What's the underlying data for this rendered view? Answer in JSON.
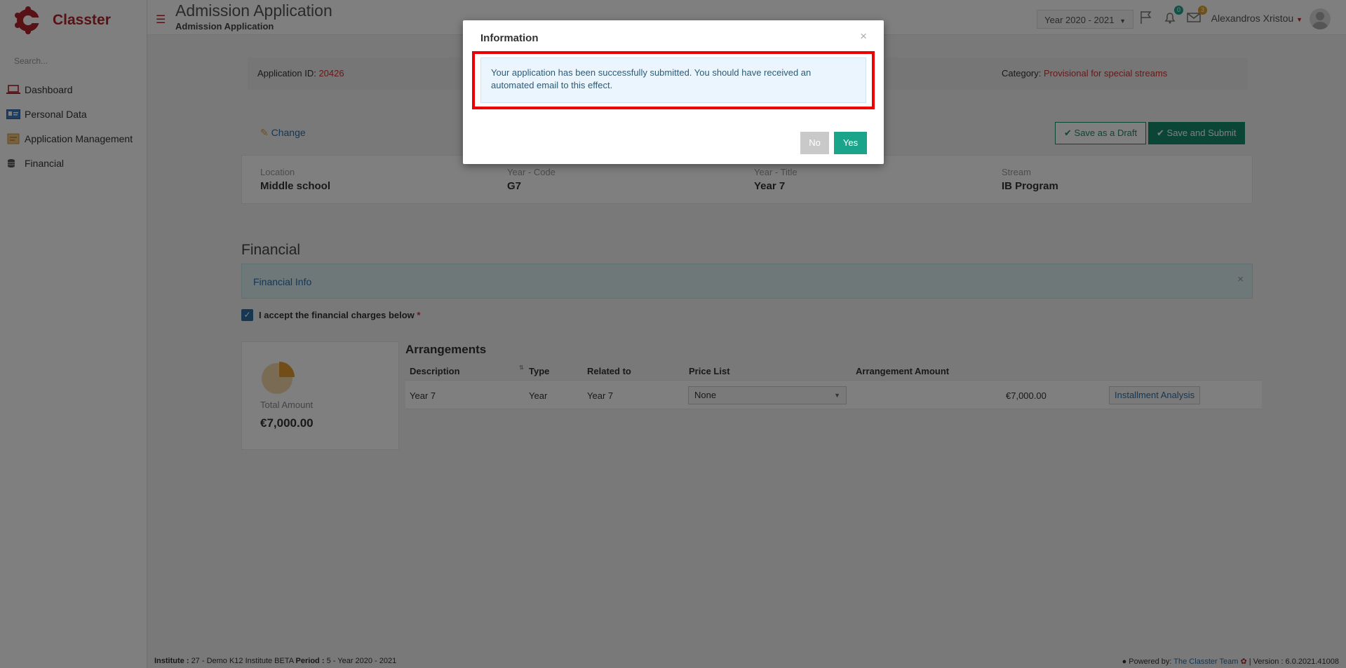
{
  "app": {
    "brand": "Classter"
  },
  "sidebar": {
    "search_placeholder": "Search...",
    "items": [
      {
        "label": "Dashboard",
        "icon": "laptop-icon"
      },
      {
        "label": "Personal Data",
        "icon": "id-card-icon"
      },
      {
        "label": "Application Management",
        "icon": "folder-icon"
      },
      {
        "label": "Financial",
        "icon": "coins-icon"
      }
    ]
  },
  "header": {
    "title": "Admission Application",
    "subtitle": "Admission Application",
    "year_select": "Year 2020 - 2021",
    "notifications_count": "0",
    "messages_count": "3",
    "user_name": "Alexandros Xristou"
  },
  "application": {
    "id_label": "Application ID:",
    "id_value": "20426",
    "category_label": "Category:",
    "category_value": "Provisional for special streams",
    "change_label": "Change",
    "save_draft_label": "Save as a Draft",
    "save_submit_label": "Save and Submit"
  },
  "details": {
    "location_label": "Location",
    "location_value": "Middle school",
    "year_code_label": "Year - Code",
    "year_code_value": "G7",
    "year_title_label": "Year - Title",
    "year_title_value": "Year 7",
    "stream_label": "Stream",
    "stream_value": "IB Program"
  },
  "financial": {
    "section_title": "Financial",
    "info_text": "Financial Info",
    "info_close": "×",
    "accept_label": "I accept the financial charges below",
    "required_mark": "*",
    "total_label": "Total Amount",
    "total_value": "€7,000.00",
    "arrangements_title": "Arrangements",
    "columns": [
      "Description",
      "Type",
      "Related to",
      "Price List",
      "Arrangement Amount"
    ],
    "row": {
      "description": "Year 7",
      "type": "Year",
      "related_to": "Year 7",
      "price_list": "None",
      "amount": "€7,000.00",
      "action": "Installment Analysis"
    }
  },
  "footer": {
    "institute_label": "Institute :",
    "institute_value": "27 - Demo K12 Institute BETA",
    "period_label": "Period :",
    "period_value": "5 - Year 2020 - 2021",
    "powered_by": "Powered by:",
    "team": "The Classter Team",
    "version": "| Version : 6.0.2021.41008"
  },
  "modal": {
    "title": "Information",
    "close": "×",
    "message": "Your  application has been successfully submitted. You should have received an automated email to this effect.",
    "no_label": "No",
    "yes_label": "Yes"
  },
  "colors": {
    "brand": "#b1232a",
    "primary": "#178a6b",
    "highlight": "#e00000"
  }
}
